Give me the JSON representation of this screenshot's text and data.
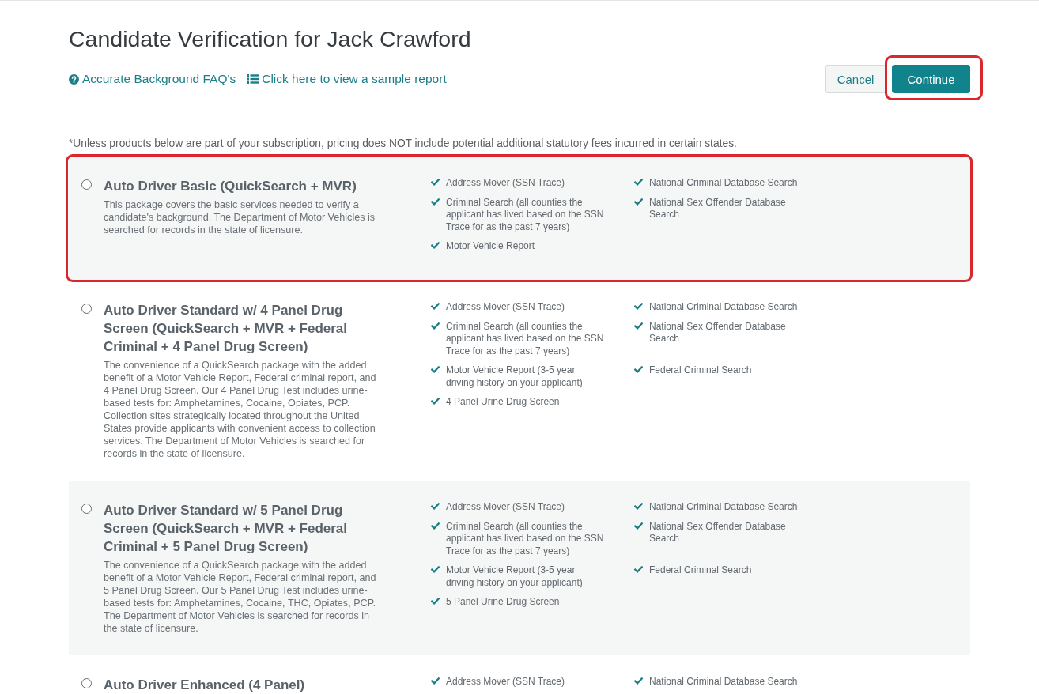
{
  "page": {
    "title": "Candidate Verification for Jack Crawford"
  },
  "links": [
    {
      "kind": "help",
      "label": "Accurate Background FAQ's"
    },
    {
      "kind": "list",
      "label": "Click here to view a sample report"
    }
  ],
  "buttons": [
    {
      "kind": "secondary",
      "label": "Cancel",
      "highlighted": false
    },
    {
      "kind": "primary",
      "label": "Continue",
      "highlighted": true
    }
  ],
  "note": "*Unless products below are part of your subscription, pricing does NOT include potential additional statutory fees incurred in certain states.",
  "packages": [
    {
      "name": "Auto Driver Basic (QuickSearch + MVR)",
      "description": "This package covers the basic services needed to verify a candidate's background. The Department of Motor Vehicles is searched for records in the state of licensure.",
      "selected": false,
      "highlighted": true,
      "features": [
        "Address Mover (SSN Trace)",
        "National Criminal Database Search",
        "Criminal Search (all counties the applicant has lived based on the SSN Trace for as the past 7 years)",
        "National Sex Offender Database Search",
        "Motor Vehicle Report"
      ]
    },
    {
      "name": "Auto Driver Standard w/ 4 Panel Drug Screen (QuickSearch + MVR + Federal Criminal + 4 Panel Drug Screen)",
      "description": "The convenience of a QuickSearch package with the added benefit of a Motor Vehicle Report, Federal criminal report, and 4 Panel Drug Screen. Our 4 Panel Drug Test includes urine-based tests for: Amphetamines, Cocaine, Opiates, PCP. Collection sites strategically located throughout the United States provide applicants with convenient access to collection services. The Department of Motor Vehicles is searched for records in the state of licensure.",
      "selected": false,
      "highlighted": false,
      "features": [
        "Address Mover (SSN Trace)",
        "National Criminal Database Search",
        "Criminal Search (all counties the applicant has lived based on the SSN Trace for as the past 7 years)",
        "National Sex Offender Database Search",
        "Motor Vehicle Report (3-5 year driving history on your applicant)",
        "Federal Criminal Search",
        "4 Panel Urine Drug Screen"
      ]
    },
    {
      "name": "Auto Driver Standard w/ 5 Panel Drug Screen (QuickSearch + MVR + Federal Criminal + 5 Panel Drug Screen)",
      "description": "The convenience of a QuickSearch package with the added benefit of a Motor Vehicle Report, Federal criminal report, and 5 Panel Drug Screen. Our 5 Panel Drug Test includes urine-based tests for: Amphetamines, Cocaine, THC, Opiates, PCP. The Department of Motor Vehicles is searched for records in the state of licensure.",
      "selected": false,
      "highlighted": false,
      "features": [
        "Address Mover (SSN Trace)",
        "National Criminal Database Search",
        "Criminal Search (all counties the applicant has lived based on the SSN Trace for as the past 7 years)",
        "National Sex Offender Database Search",
        "Motor Vehicle Report (3-5 year driving history on your applicant)",
        "Federal Criminal Search",
        "5 Panel Urine Drug Screen"
      ]
    },
    {
      "name": "Auto Driver Enhanced (4 Panel)",
      "selected": false,
      "highlighted": false,
      "features": [
        "Address Mover (SSN Trace)",
        "National Criminal Database Search"
      ]
    }
  ]
}
